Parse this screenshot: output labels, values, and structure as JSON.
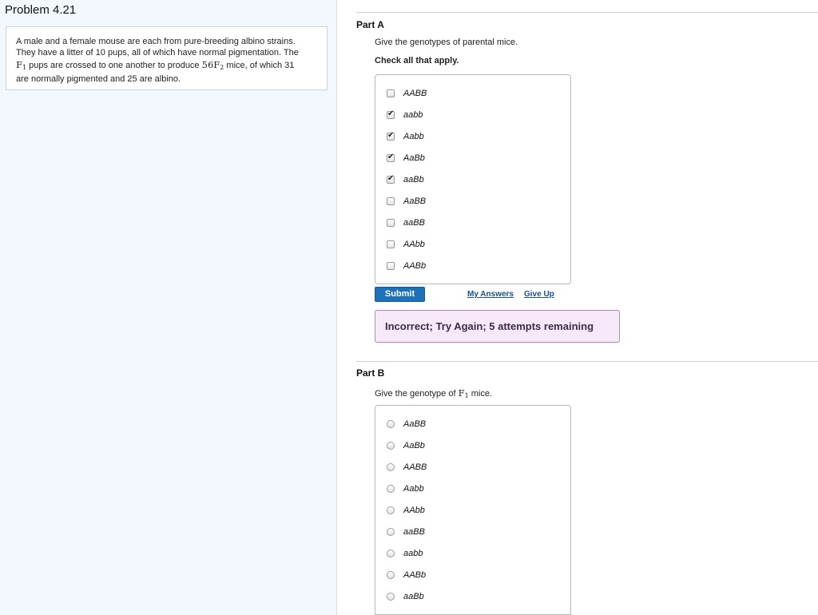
{
  "problem": {
    "title": "Problem 4.21",
    "text_line1": "A male and a female mouse are each from pure-breeding albino strains.",
    "text_line2": "They have a litter of 10 pups, all of which have normal pigmentation. The",
    "text_line3_f": "F",
    "text_line3_f_sub": "1",
    "text_line3_a": " pups are crossed to one another to produce ",
    "text_line3_num": "56F",
    "text_line3_num_sub": "2",
    "text_line3_b": " mice, of which 31",
    "text_line4": "are normally pigmented and 25 are albino."
  },
  "part_a": {
    "title": "Part A",
    "prompt": "Give the genotypes of parental mice.",
    "instruction": "Check all that apply.",
    "options": [
      {
        "label": "AABB",
        "checked": false
      },
      {
        "label": "aabb",
        "checked": true
      },
      {
        "label": "Aabb",
        "checked": true
      },
      {
        "label": "AaBb",
        "checked": true
      },
      {
        "label": "aaBb",
        "checked": true
      },
      {
        "label": "AaBB",
        "checked": false
      },
      {
        "label": "aaBB",
        "checked": false
      },
      {
        "label": "AAbb",
        "checked": false
      },
      {
        "label": "AABb",
        "checked": false
      }
    ],
    "submit_label": "Submit",
    "my_answers_label": "My Answers",
    "give_up_label": "Give Up",
    "feedback": "Incorrect; Try Again; 5 attempts remaining"
  },
  "part_b": {
    "title": "Part B",
    "prompt_a": "Give the genotype of ",
    "prompt_f": "F",
    "prompt_f_sub": "1",
    "prompt_b": " mice.",
    "options": [
      {
        "label": "AaBB"
      },
      {
        "label": "AaBb"
      },
      {
        "label": "AABB"
      },
      {
        "label": "Aabb"
      },
      {
        "label": "AAbb"
      },
      {
        "label": "aaBB"
      },
      {
        "label": "aabb"
      },
      {
        "label": "AABb"
      },
      {
        "label": "aaBb"
      }
    ]
  }
}
